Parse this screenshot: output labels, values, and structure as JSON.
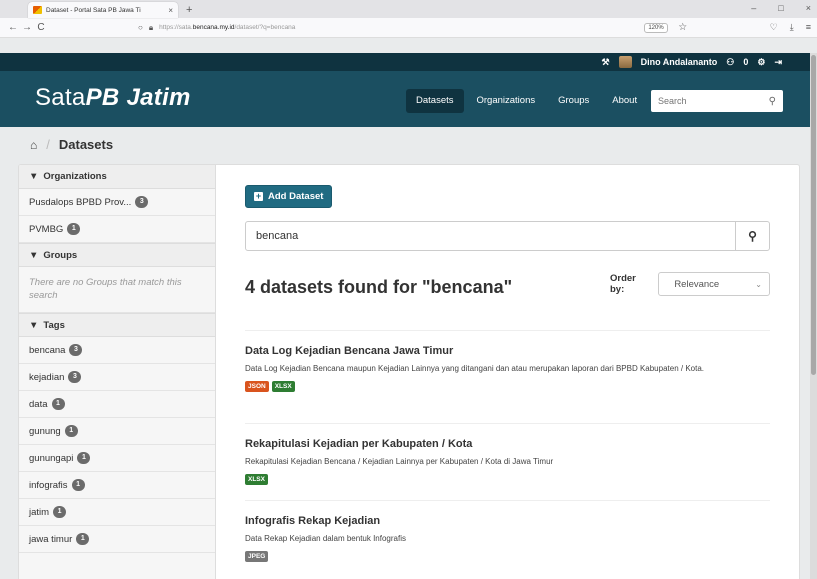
{
  "browser": {
    "tab_title": "Dataset - Portal Sata PB Jawa Ti",
    "tab_close": "×",
    "new_tab": "+",
    "win_minimize": "–",
    "win_maximize": "□",
    "win_close": "×",
    "back": "←",
    "forward": "→",
    "reload": "C",
    "url_prefix": "https://sata.",
    "url_domain": "bencana.my.id",
    "url_path": "/dataset/?q=bencana",
    "zoom": "120%"
  },
  "account": {
    "user_name": "Dino Andalananto",
    "dashboard_count": "0"
  },
  "site": {
    "logo_plain": "Sata",
    "logo_italic": "PB Jatim",
    "nav": [
      {
        "label": "Datasets",
        "active": true
      },
      {
        "label": "Organizations"
      },
      {
        "label": "Groups"
      },
      {
        "label": "About"
      }
    ],
    "search_placeholder": "Search"
  },
  "breadcrumb": {
    "current": "Datasets"
  },
  "sidebar": {
    "organizations_title": "Organizations",
    "organizations": [
      {
        "label": "Pusdalops BPBD Prov...",
        "count": "3"
      },
      {
        "label": "PVMBG",
        "count": "1"
      }
    ],
    "groups_title": "Groups",
    "groups_empty": "There are no Groups that match this search",
    "tags_title": "Tags",
    "tags": [
      {
        "label": "bencana",
        "count": "3"
      },
      {
        "label": "kejadian",
        "count": "3"
      },
      {
        "label": "data",
        "count": "1"
      },
      {
        "label": "gunung",
        "count": "1"
      },
      {
        "label": "gunungapi",
        "count": "1"
      },
      {
        "label": "infografis",
        "count": "1"
      },
      {
        "label": "jatim",
        "count": "1"
      },
      {
        "label": "jawa timur",
        "count": "1"
      }
    ]
  },
  "main": {
    "add_dataset_label": "Add Dataset",
    "search_value": "bencana",
    "result_count": "4 datasets found for \"bencana\"",
    "order_by_label": "Order by:",
    "order_by_value": "Relevance",
    "datasets": [
      {
        "title": "Data Log Kejadian Bencana Jawa Timur",
        "notes": "Data Log Kejadian Bencana maupun Kejadian Lainnya yang ditangani dan atau merupakan laporan dari BPBD Kabupaten / Kota.",
        "resources": [
          {
            "format": "JSON",
            "color": "#d9541e"
          },
          {
            "format": "XLSX",
            "color": "#2e7d32"
          }
        ]
      },
      {
        "title": "Rekapitulasi Kejadian per Kabupaten / Kota",
        "notes": "Rekapitulasi Kejadian Bencana / Kejadian Lainnya per Kabupaten / Kota di Jawa Timur",
        "resources": [
          {
            "format": "XLSX",
            "color": "#2e7d32"
          }
        ]
      },
      {
        "title": "Infografis Rekap Kejadian",
        "notes": "Data Rekap Kejadian dalam bentuk Infografis",
        "resources": [
          {
            "format": "JPEG",
            "color": "#777777"
          }
        ]
      }
    ]
  },
  "colors": {
    "masthead": "#1b4f61",
    "account_bar": "#0f3340",
    "primary_button": "#206b82"
  }
}
